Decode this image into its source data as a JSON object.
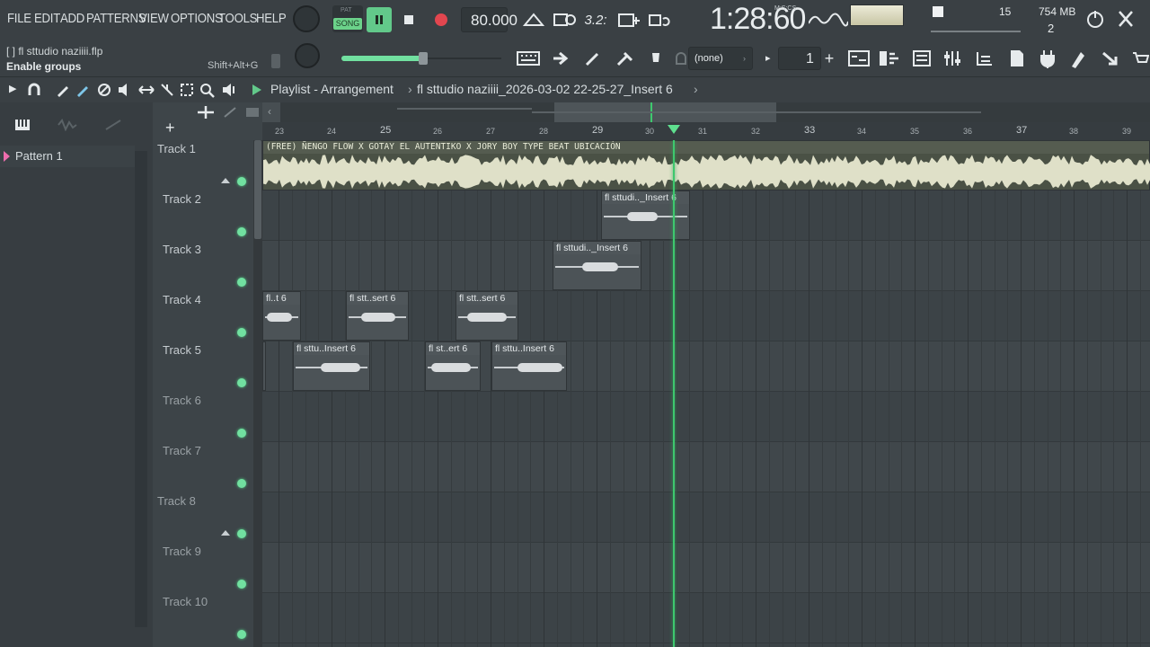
{
  "menu": [
    "FILE",
    "EDIT",
    "ADD",
    "PATTERNS",
    "VIEW",
    "OPTIONS",
    "TOOLS",
    "HELP"
  ],
  "hint": {
    "project": "[  ]  fl sttudio naziiii.flp",
    "action": "Enable groups",
    "shortcut": "Shift+Alt+G"
  },
  "transport": {
    "pat_label": "PAT",
    "song_label": "SONG",
    "tempo": "80.000",
    "time": "1:28:60",
    "time_unit": "M:S:CS",
    "cpu": "15",
    "memory": "754 MB",
    "voices": "2",
    "pattern_num": "1",
    "snap": "(none)"
  },
  "playlist": {
    "title": "Playlist - Arrangement",
    "breadcrumb": "fl sttudio naziiii_2026-03-02 22-25-27_Insert 6"
  },
  "browser": {
    "pattern": "Pattern 1"
  },
  "ruler": [
    "23",
    "24",
    "25",
    "26",
    "27",
    "28",
    "29",
    "30",
    "31",
    "32",
    "33",
    "34",
    "35",
    "36",
    "37",
    "38",
    "39"
  ],
  "tracks": [
    {
      "name": "Track 1"
    },
    {
      "name": "Track 2"
    },
    {
      "name": "Track 3"
    },
    {
      "name": "Track 4"
    },
    {
      "name": "Track 5"
    },
    {
      "name": "Track 6"
    },
    {
      "name": "Track 7"
    },
    {
      "name": "Track 8"
    },
    {
      "name": "Track 9"
    },
    {
      "name": "Track 10"
    }
  ],
  "clips": {
    "t1": "(FREE) ÑENGO FLOW X GOTAY EL AUTENTIKO X JORY BOY TYPE BEAT UBICACIÓN",
    "t2": "fl sttudi.._Insert 6",
    "t3": "fl sttudi.._Insert 6",
    "t4a": "fl..t 6",
    "t4b": "fl stt..sert 6",
    "t4c": "fl stt..sert 6",
    "t5a": "fl sttu..Insert 6",
    "t5b": "fl st..ert 6",
    "t5c": "fl sttu..Insert 6"
  },
  "colors": {
    "accent_green": "#71e0a0",
    "playhead": "#3ec86e",
    "audio_wave": "#dfe0c8"
  }
}
